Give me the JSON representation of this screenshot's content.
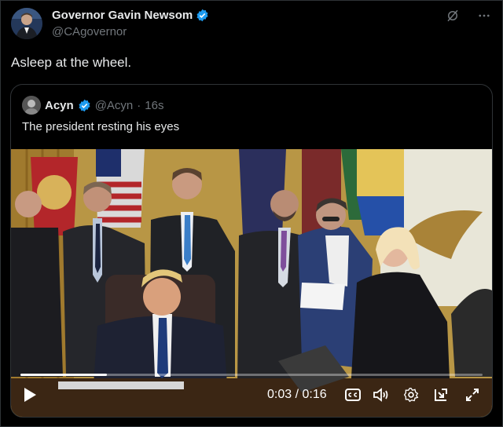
{
  "author": {
    "display_name": "Governor Gavin Newsom",
    "handle": "@CAgovernor",
    "avatar_icon": "avatar-photo",
    "verified_icon": "verified-badge-icon"
  },
  "header_actions": {
    "grok_icon": "grok-icon",
    "more_icon": "more-options-icon"
  },
  "tweet": {
    "text": "Asleep at the wheel."
  },
  "quoted": {
    "display_name": "Acyn",
    "handle": "@Acyn",
    "separator": "·",
    "time": "16s",
    "text": "The president resting his eyes"
  },
  "video": {
    "time_display": "0:03 / 0:16",
    "progress": 0.1875,
    "controls": [
      "play-icon",
      "captions-icon",
      "volume-icon",
      "settings-icon",
      "pip-icon",
      "fullscreen-icon"
    ]
  },
  "colors": {
    "background": "#000000",
    "text": "#e7e9ea",
    "muted": "#71767b",
    "verified": "#1d9bf0",
    "border": "#2f3336"
  }
}
